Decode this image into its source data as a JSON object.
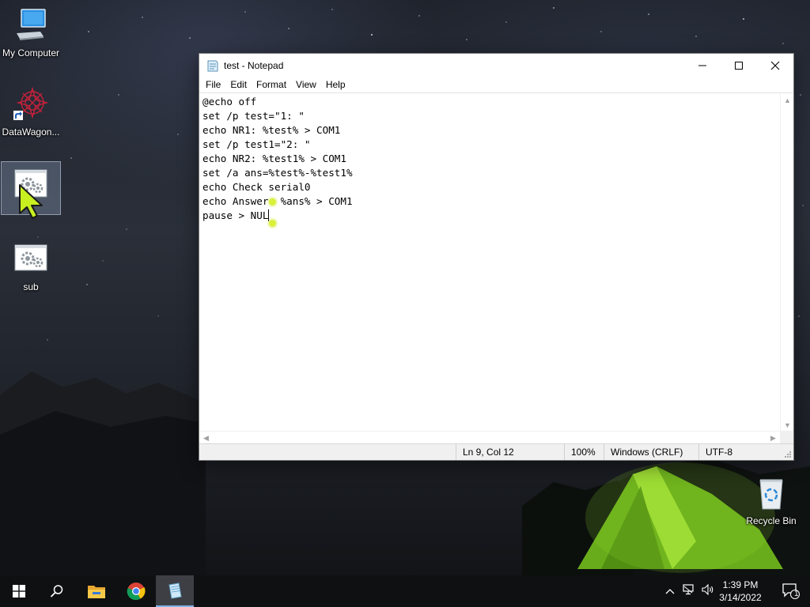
{
  "desktop": {
    "icons": [
      {
        "label": "My Computer"
      },
      {
        "label": "DataWagon..."
      },
      {
        "label": ""
      },
      {
        "label": "sub"
      },
      {
        "label": "Recycle Bin"
      }
    ]
  },
  "notepad": {
    "title": "test - Notepad",
    "menu": [
      "File",
      "Edit",
      "Format",
      "View",
      "Help"
    ],
    "lines": [
      "@echo off",
      "set /p test=\"1: \"",
      "echo NR1: %test% > COM1",
      "set /p test1=\"2: \"",
      "echo NR2: %test1% > COM1",
      "set /a ans=%test%-%test1%",
      "echo Check serial0",
      "echo Answer: %ans% > COM1",
      "pause > NUL"
    ],
    "status": {
      "position": "Ln 9, Col 12",
      "zoom": "100%",
      "line_ending": "Windows (CRLF)",
      "encoding": "UTF-8"
    }
  },
  "taskbar": {
    "time": "1:39 PM",
    "date": "3/14/2022",
    "notification_count": "1"
  },
  "colors": {
    "taskbar": "#0f1012",
    "active_indicator": "#7fb3e8",
    "touch_marker": "#d9f13a",
    "cursor": "#c8f020"
  }
}
